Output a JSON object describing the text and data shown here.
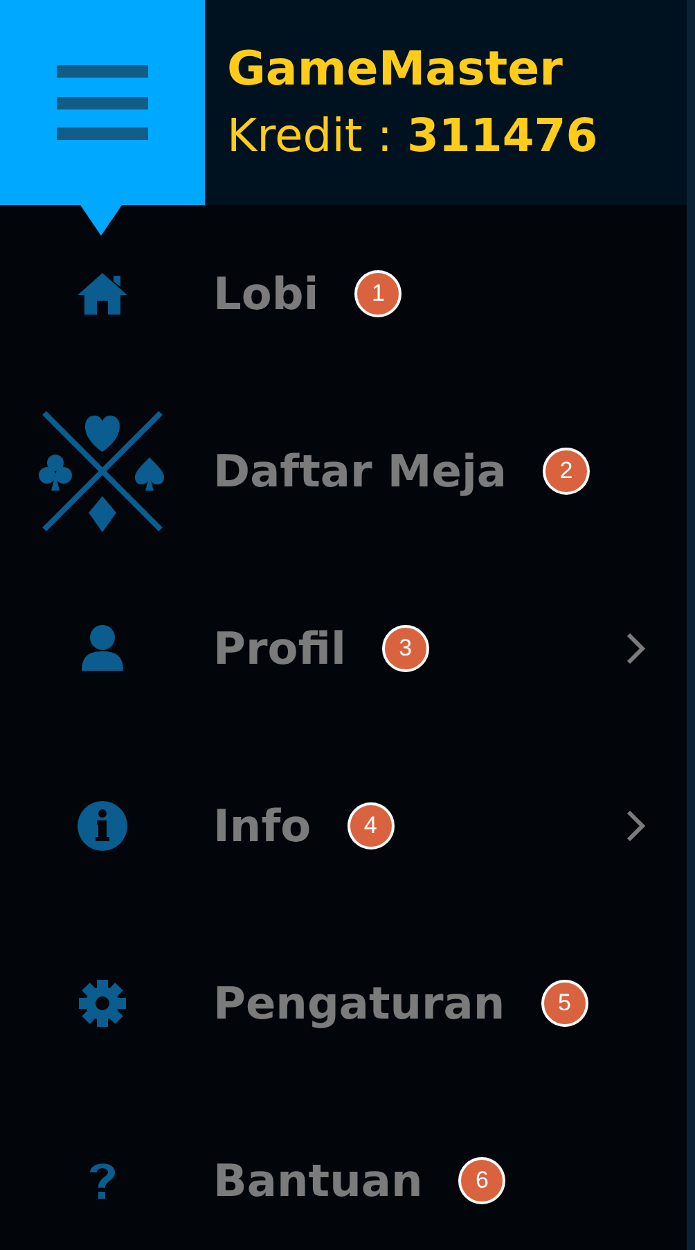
{
  "header": {
    "username": "GameMaster",
    "credit": "Kredit : **311476**"
  },
  "menu": [
    {
      "label": "Lobi",
      "badge": "1",
      "has_submenu": false
    },
    {
      "label": "Daftar Meja",
      "badge": "2",
      "has_submenu": false
    },
    {
      "label": "Profil",
      "badge": "3",
      "has_submenu": true
    },
    {
      "label": "Info",
      "badge": "4",
      "has_submenu": true
    },
    {
      "label": "Pengaturan",
      "badge": "5",
      "has_submenu": false
    },
    {
      "label": "Bantuan",
      "badge": "6",
      "has_submenu": false
    }
  ]
}
